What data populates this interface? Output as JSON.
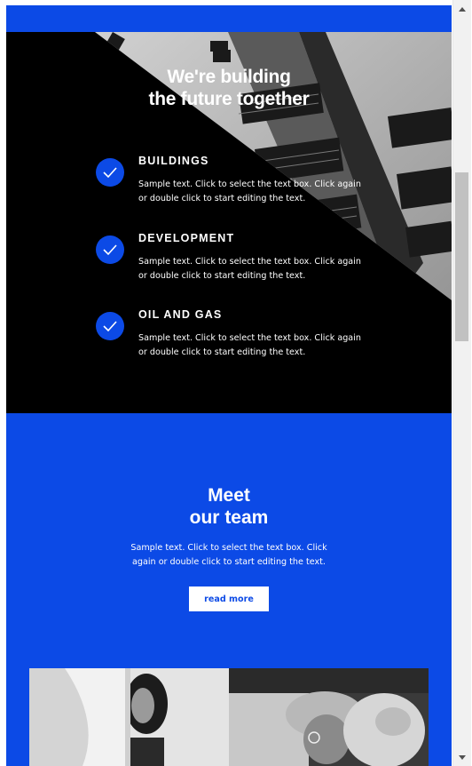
{
  "hero": {
    "title_line1": "We're building",
    "title_line2": "the future together",
    "features": [
      {
        "title": "BUILDINGS",
        "text": "Sample text. Click to select the text box. Click again or double click to start editing the text.",
        "icon": "check-icon"
      },
      {
        "title": "DEVELOPMENT",
        "text": "Sample text. Click to select the text box. Click again or double click to start editing the text.",
        "icon": "check-icon"
      },
      {
        "title": "OIL AND GAS",
        "text": "Sample text. Click to select the text box. Click again or double click to start editing the text.",
        "icon": "check-icon"
      }
    ]
  },
  "team": {
    "title_line1": "Meet",
    "title_line2": "our team",
    "text": "Sample text. Click to select the text box. Click again or double click to start editing the text.",
    "button_label": "read more"
  },
  "colors": {
    "accent": "#0c4ae6",
    "hero_bg": "#000000",
    "button_bg": "#ffffff"
  }
}
